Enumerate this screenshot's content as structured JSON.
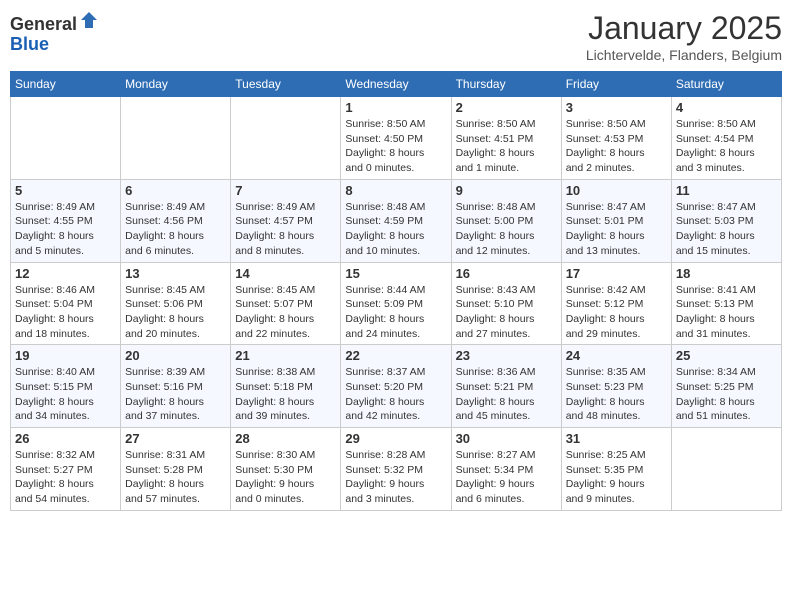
{
  "header": {
    "logo_general": "General",
    "logo_blue": "Blue",
    "month": "January 2025",
    "location": "Lichtervelde, Flanders, Belgium"
  },
  "days_of_week": [
    "Sunday",
    "Monday",
    "Tuesday",
    "Wednesday",
    "Thursday",
    "Friday",
    "Saturday"
  ],
  "weeks": [
    [
      {
        "day": "",
        "info": ""
      },
      {
        "day": "",
        "info": ""
      },
      {
        "day": "",
        "info": ""
      },
      {
        "day": "1",
        "info": "Sunrise: 8:50 AM\nSunset: 4:50 PM\nDaylight: 8 hours\nand 0 minutes."
      },
      {
        "day": "2",
        "info": "Sunrise: 8:50 AM\nSunset: 4:51 PM\nDaylight: 8 hours\nand 1 minute."
      },
      {
        "day": "3",
        "info": "Sunrise: 8:50 AM\nSunset: 4:53 PM\nDaylight: 8 hours\nand 2 minutes."
      },
      {
        "day": "4",
        "info": "Sunrise: 8:50 AM\nSunset: 4:54 PM\nDaylight: 8 hours\nand 3 minutes."
      }
    ],
    [
      {
        "day": "5",
        "info": "Sunrise: 8:49 AM\nSunset: 4:55 PM\nDaylight: 8 hours\nand 5 minutes."
      },
      {
        "day": "6",
        "info": "Sunrise: 8:49 AM\nSunset: 4:56 PM\nDaylight: 8 hours\nand 6 minutes."
      },
      {
        "day": "7",
        "info": "Sunrise: 8:49 AM\nSunset: 4:57 PM\nDaylight: 8 hours\nand 8 minutes."
      },
      {
        "day": "8",
        "info": "Sunrise: 8:48 AM\nSunset: 4:59 PM\nDaylight: 8 hours\nand 10 minutes."
      },
      {
        "day": "9",
        "info": "Sunrise: 8:48 AM\nSunset: 5:00 PM\nDaylight: 8 hours\nand 12 minutes."
      },
      {
        "day": "10",
        "info": "Sunrise: 8:47 AM\nSunset: 5:01 PM\nDaylight: 8 hours\nand 13 minutes."
      },
      {
        "day": "11",
        "info": "Sunrise: 8:47 AM\nSunset: 5:03 PM\nDaylight: 8 hours\nand 15 minutes."
      }
    ],
    [
      {
        "day": "12",
        "info": "Sunrise: 8:46 AM\nSunset: 5:04 PM\nDaylight: 8 hours\nand 18 minutes."
      },
      {
        "day": "13",
        "info": "Sunrise: 8:45 AM\nSunset: 5:06 PM\nDaylight: 8 hours\nand 20 minutes."
      },
      {
        "day": "14",
        "info": "Sunrise: 8:45 AM\nSunset: 5:07 PM\nDaylight: 8 hours\nand 22 minutes."
      },
      {
        "day": "15",
        "info": "Sunrise: 8:44 AM\nSunset: 5:09 PM\nDaylight: 8 hours\nand 24 minutes."
      },
      {
        "day": "16",
        "info": "Sunrise: 8:43 AM\nSunset: 5:10 PM\nDaylight: 8 hours\nand 27 minutes."
      },
      {
        "day": "17",
        "info": "Sunrise: 8:42 AM\nSunset: 5:12 PM\nDaylight: 8 hours\nand 29 minutes."
      },
      {
        "day": "18",
        "info": "Sunrise: 8:41 AM\nSunset: 5:13 PM\nDaylight: 8 hours\nand 31 minutes."
      }
    ],
    [
      {
        "day": "19",
        "info": "Sunrise: 8:40 AM\nSunset: 5:15 PM\nDaylight: 8 hours\nand 34 minutes."
      },
      {
        "day": "20",
        "info": "Sunrise: 8:39 AM\nSunset: 5:16 PM\nDaylight: 8 hours\nand 37 minutes."
      },
      {
        "day": "21",
        "info": "Sunrise: 8:38 AM\nSunset: 5:18 PM\nDaylight: 8 hours\nand 39 minutes."
      },
      {
        "day": "22",
        "info": "Sunrise: 8:37 AM\nSunset: 5:20 PM\nDaylight: 8 hours\nand 42 minutes."
      },
      {
        "day": "23",
        "info": "Sunrise: 8:36 AM\nSunset: 5:21 PM\nDaylight: 8 hours\nand 45 minutes."
      },
      {
        "day": "24",
        "info": "Sunrise: 8:35 AM\nSunset: 5:23 PM\nDaylight: 8 hours\nand 48 minutes."
      },
      {
        "day": "25",
        "info": "Sunrise: 8:34 AM\nSunset: 5:25 PM\nDaylight: 8 hours\nand 51 minutes."
      }
    ],
    [
      {
        "day": "26",
        "info": "Sunrise: 8:32 AM\nSunset: 5:27 PM\nDaylight: 8 hours\nand 54 minutes."
      },
      {
        "day": "27",
        "info": "Sunrise: 8:31 AM\nSunset: 5:28 PM\nDaylight: 8 hours\nand 57 minutes."
      },
      {
        "day": "28",
        "info": "Sunrise: 8:30 AM\nSunset: 5:30 PM\nDaylight: 9 hours\nand 0 minutes."
      },
      {
        "day": "29",
        "info": "Sunrise: 8:28 AM\nSunset: 5:32 PM\nDaylight: 9 hours\nand 3 minutes."
      },
      {
        "day": "30",
        "info": "Sunrise: 8:27 AM\nSunset: 5:34 PM\nDaylight: 9 hours\nand 6 minutes."
      },
      {
        "day": "31",
        "info": "Sunrise: 8:25 AM\nSunset: 5:35 PM\nDaylight: 9 hours\nand 9 minutes."
      },
      {
        "day": "",
        "info": ""
      }
    ]
  ]
}
